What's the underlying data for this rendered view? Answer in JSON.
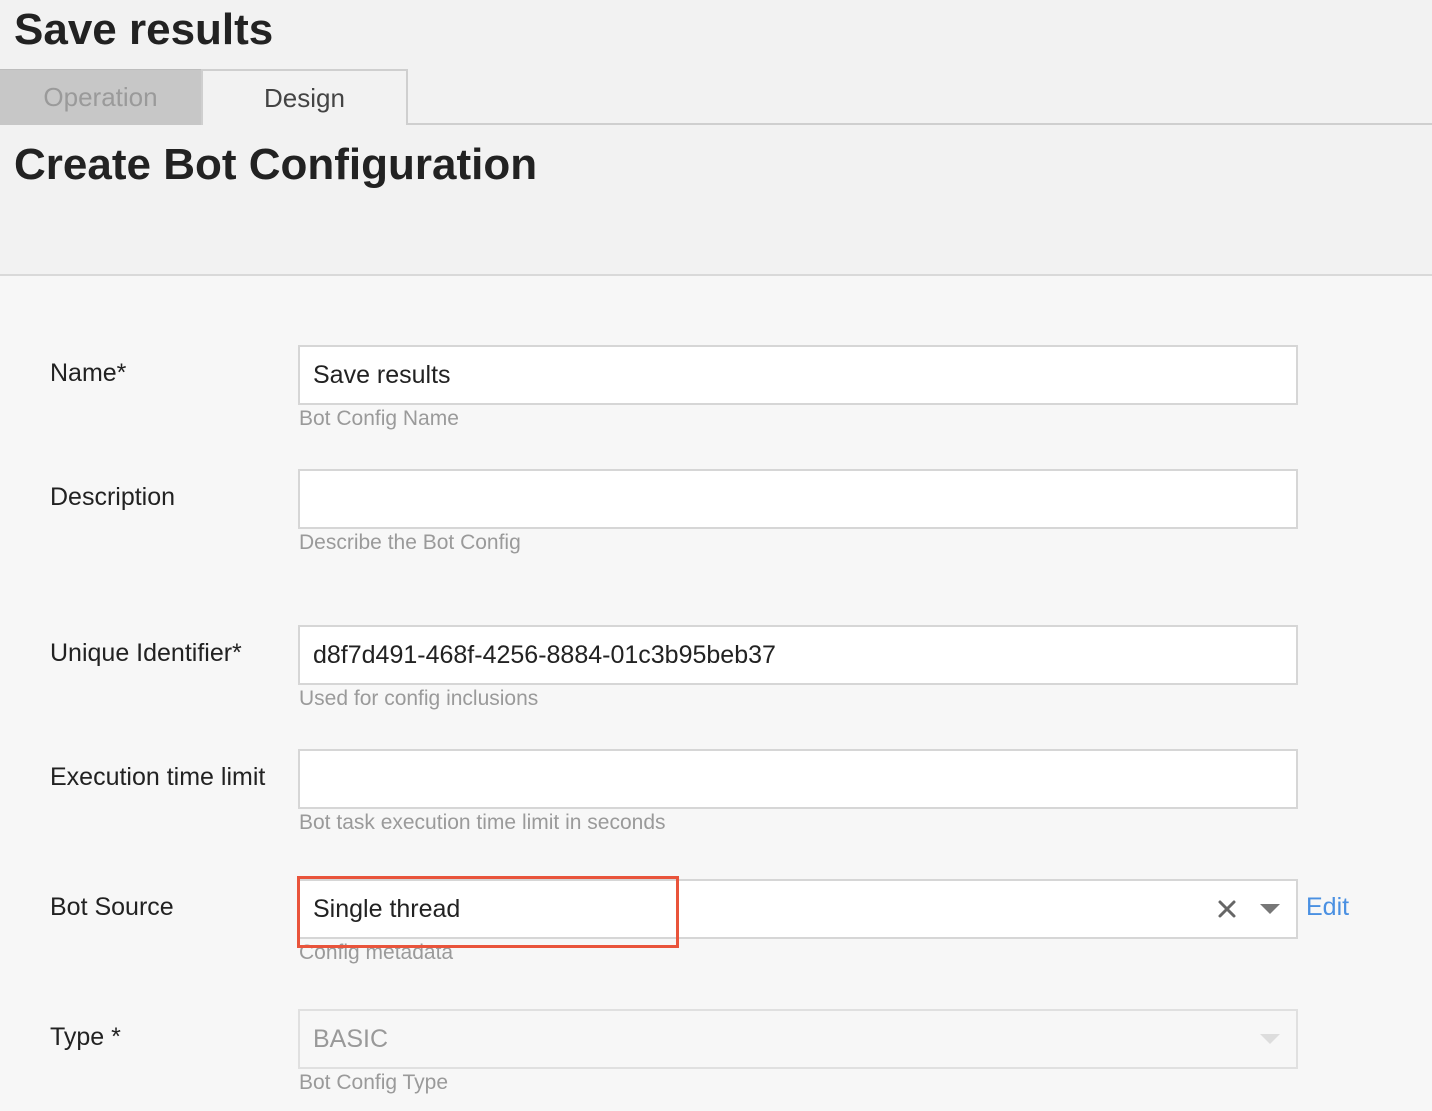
{
  "header": {
    "title": "Save results"
  },
  "tabs": [
    {
      "label": "Operation",
      "active": false
    },
    {
      "label": "Design",
      "active": true
    }
  ],
  "section": {
    "title": "Create Bot Configuration"
  },
  "form": {
    "name": {
      "label": "Name*",
      "value": "Save results",
      "help": "Bot Config Name"
    },
    "description": {
      "label": "Description",
      "value": "",
      "help": "Describe the Bot Config"
    },
    "unique_identifier": {
      "label": "Unique Identifier*",
      "value": "d8f7d491-468f-4256-8884-01c3b95beb37",
      "help": "Used for config inclusions"
    },
    "execution_time_limit": {
      "label": "Execution time limit",
      "value": "",
      "help": "Bot task execution time limit in seconds"
    },
    "bot_source": {
      "label": "Bot Source",
      "value": "Single thread",
      "help": "Config metadata",
      "edit_label": "Edit",
      "clear_icon": "close-icon",
      "dropdown_icon": "chevron-down-icon"
    },
    "type": {
      "label": "Type *",
      "value": "BASIC",
      "help": "Bot Config Type",
      "disabled": true
    }
  },
  "colors": {
    "highlight": "#e9543b",
    "link": "#4a90e2"
  }
}
